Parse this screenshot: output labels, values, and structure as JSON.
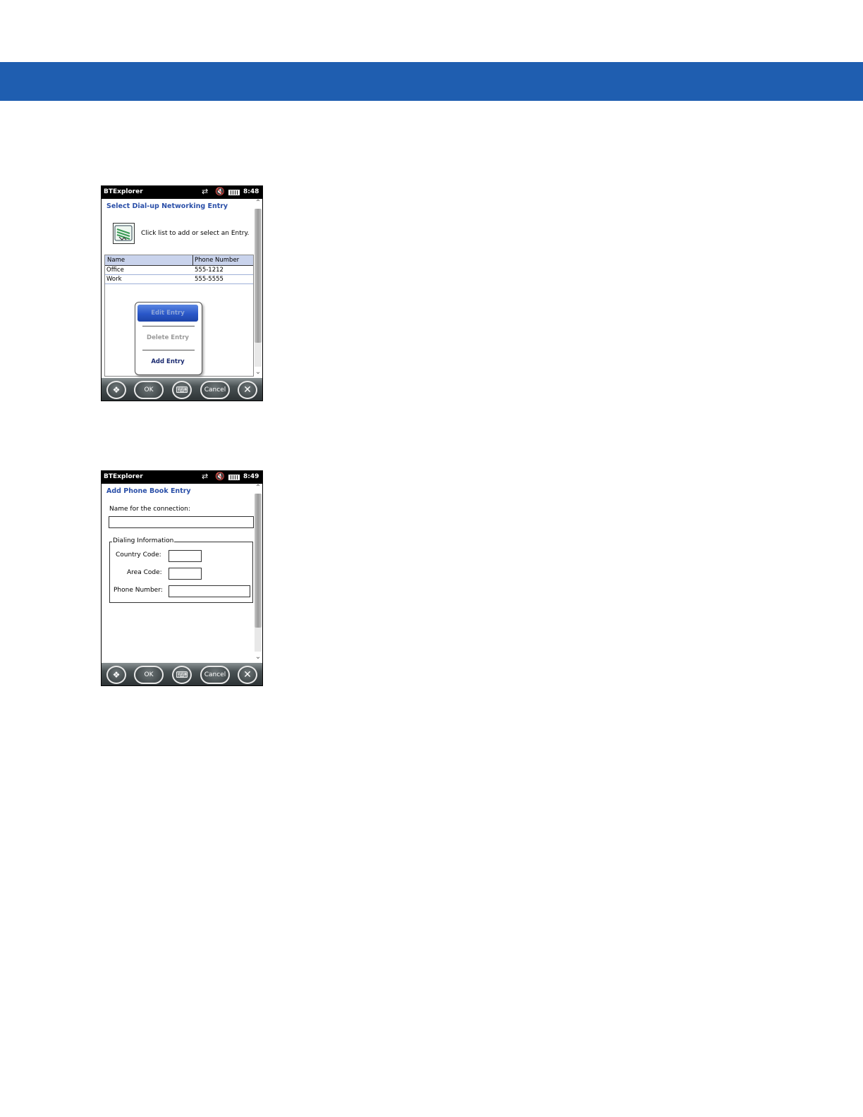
{
  "screens": [
    {
      "status": {
        "app_title": "BTExplorer",
        "time": "8:48"
      },
      "title": "Select Dial-up Networking Entry",
      "instruction": "Click list to add or select an Entry.",
      "table": {
        "columns": [
          "Name",
          "Phone Number"
        ],
        "rows": [
          {
            "name": "Office",
            "phone": "555-1212"
          },
          {
            "name": "Work",
            "phone": "555-5555"
          }
        ]
      },
      "context_menu": {
        "items": [
          "Edit Entry",
          "Delete Entry",
          "Add Entry"
        ],
        "highlighted": "Edit Entry",
        "disabled": [
          "Edit Entry",
          "Delete Entry"
        ]
      },
      "softkeys": {
        "ok": "OK",
        "cancel": "Cancel"
      }
    },
    {
      "status": {
        "app_title": "BTExplorer",
        "time": "8:49"
      },
      "title": "Add Phone Book Entry",
      "form": {
        "name_label": "Name for the connection:",
        "name_value": "",
        "group_title": "Dialing Information",
        "country_code_label": "Country Code:",
        "country_code_value": "",
        "area_code_label": "Area Code:",
        "area_code_value": "",
        "phone_number_label": "Phone Number:",
        "phone_number_value": ""
      },
      "softkeys": {
        "ok": "OK",
        "cancel": "Cancel"
      }
    }
  ],
  "colors": {
    "header_band": "#1f5eb0",
    "title_text": "#2a4fa8",
    "list_header": "#c9d3ec"
  },
  "icons": [
    "sync-icon",
    "volume-muted-icon",
    "battery-icon",
    "windows-start-icon",
    "keyboard-icon",
    "close-icon",
    "scroll-up-icon",
    "scroll-down-icon",
    "phonebook-icon"
  ]
}
